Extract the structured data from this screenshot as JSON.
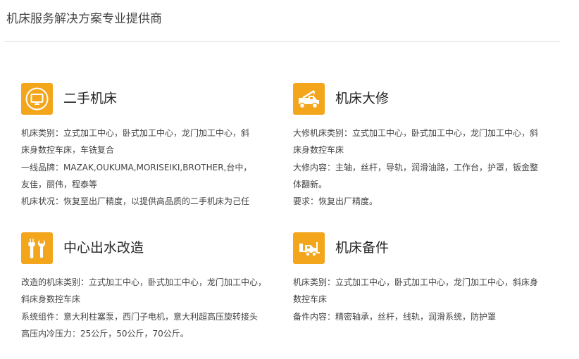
{
  "header": {
    "title": "机床服务解决方案专业提供商"
  },
  "colors": {
    "accent": "#f3a51c",
    "divider": "#dcdcdc",
    "text": "#444444"
  },
  "services": [
    {
      "icon": "monitor-icon",
      "title": "二手机床",
      "lines": [
        "机床类别：立式加工中心，卧式加工中心，龙门加工中心，斜",
        "床身数控车床，车铣复合",
        "一线品牌：MAZAK,OUKUMA,MORISEIKI,BROTHER,台中，",
        "友佳，丽伟，程泰等",
        "机床状况：恢复至出厂精度，以提供高品质的二手机床为己任"
      ]
    },
    {
      "icon": "crane-truck-icon",
      "title": "机床大修",
      "lines": [
        "大修机床类别：立式加工中心，卧式加工中心，龙门加工中心，斜",
        "床身数控车床",
        "大修内容：主轴，丝杆，导轨，润滑油路，工作台，护罩，钣金整",
        "体翻新。",
        "要求：恢复出厂精度。"
      ]
    },
    {
      "icon": "tools-icon",
      "title": "中心出水改造",
      "lines": [
        "改造的机床类别：立式加工中心，卧式加工中心，龙门加工中心，",
        "斜床身数控车床",
        "系统组件：意大利柱塞泵，西门子电机，意大利超高压旋转接头",
        "高压内冷压力：25公斤，50公斤，70公斤。"
      ]
    },
    {
      "icon": "forklift-icon",
      "title": "机床备件",
      "lines": [
        "机床类别：立式加工中心，卧式加工中心，龙门加工中心，斜床身",
        "数控车床",
        "备件内容：精密轴承，丝杆，线轨，润滑系统，防护罩"
      ]
    }
  ]
}
